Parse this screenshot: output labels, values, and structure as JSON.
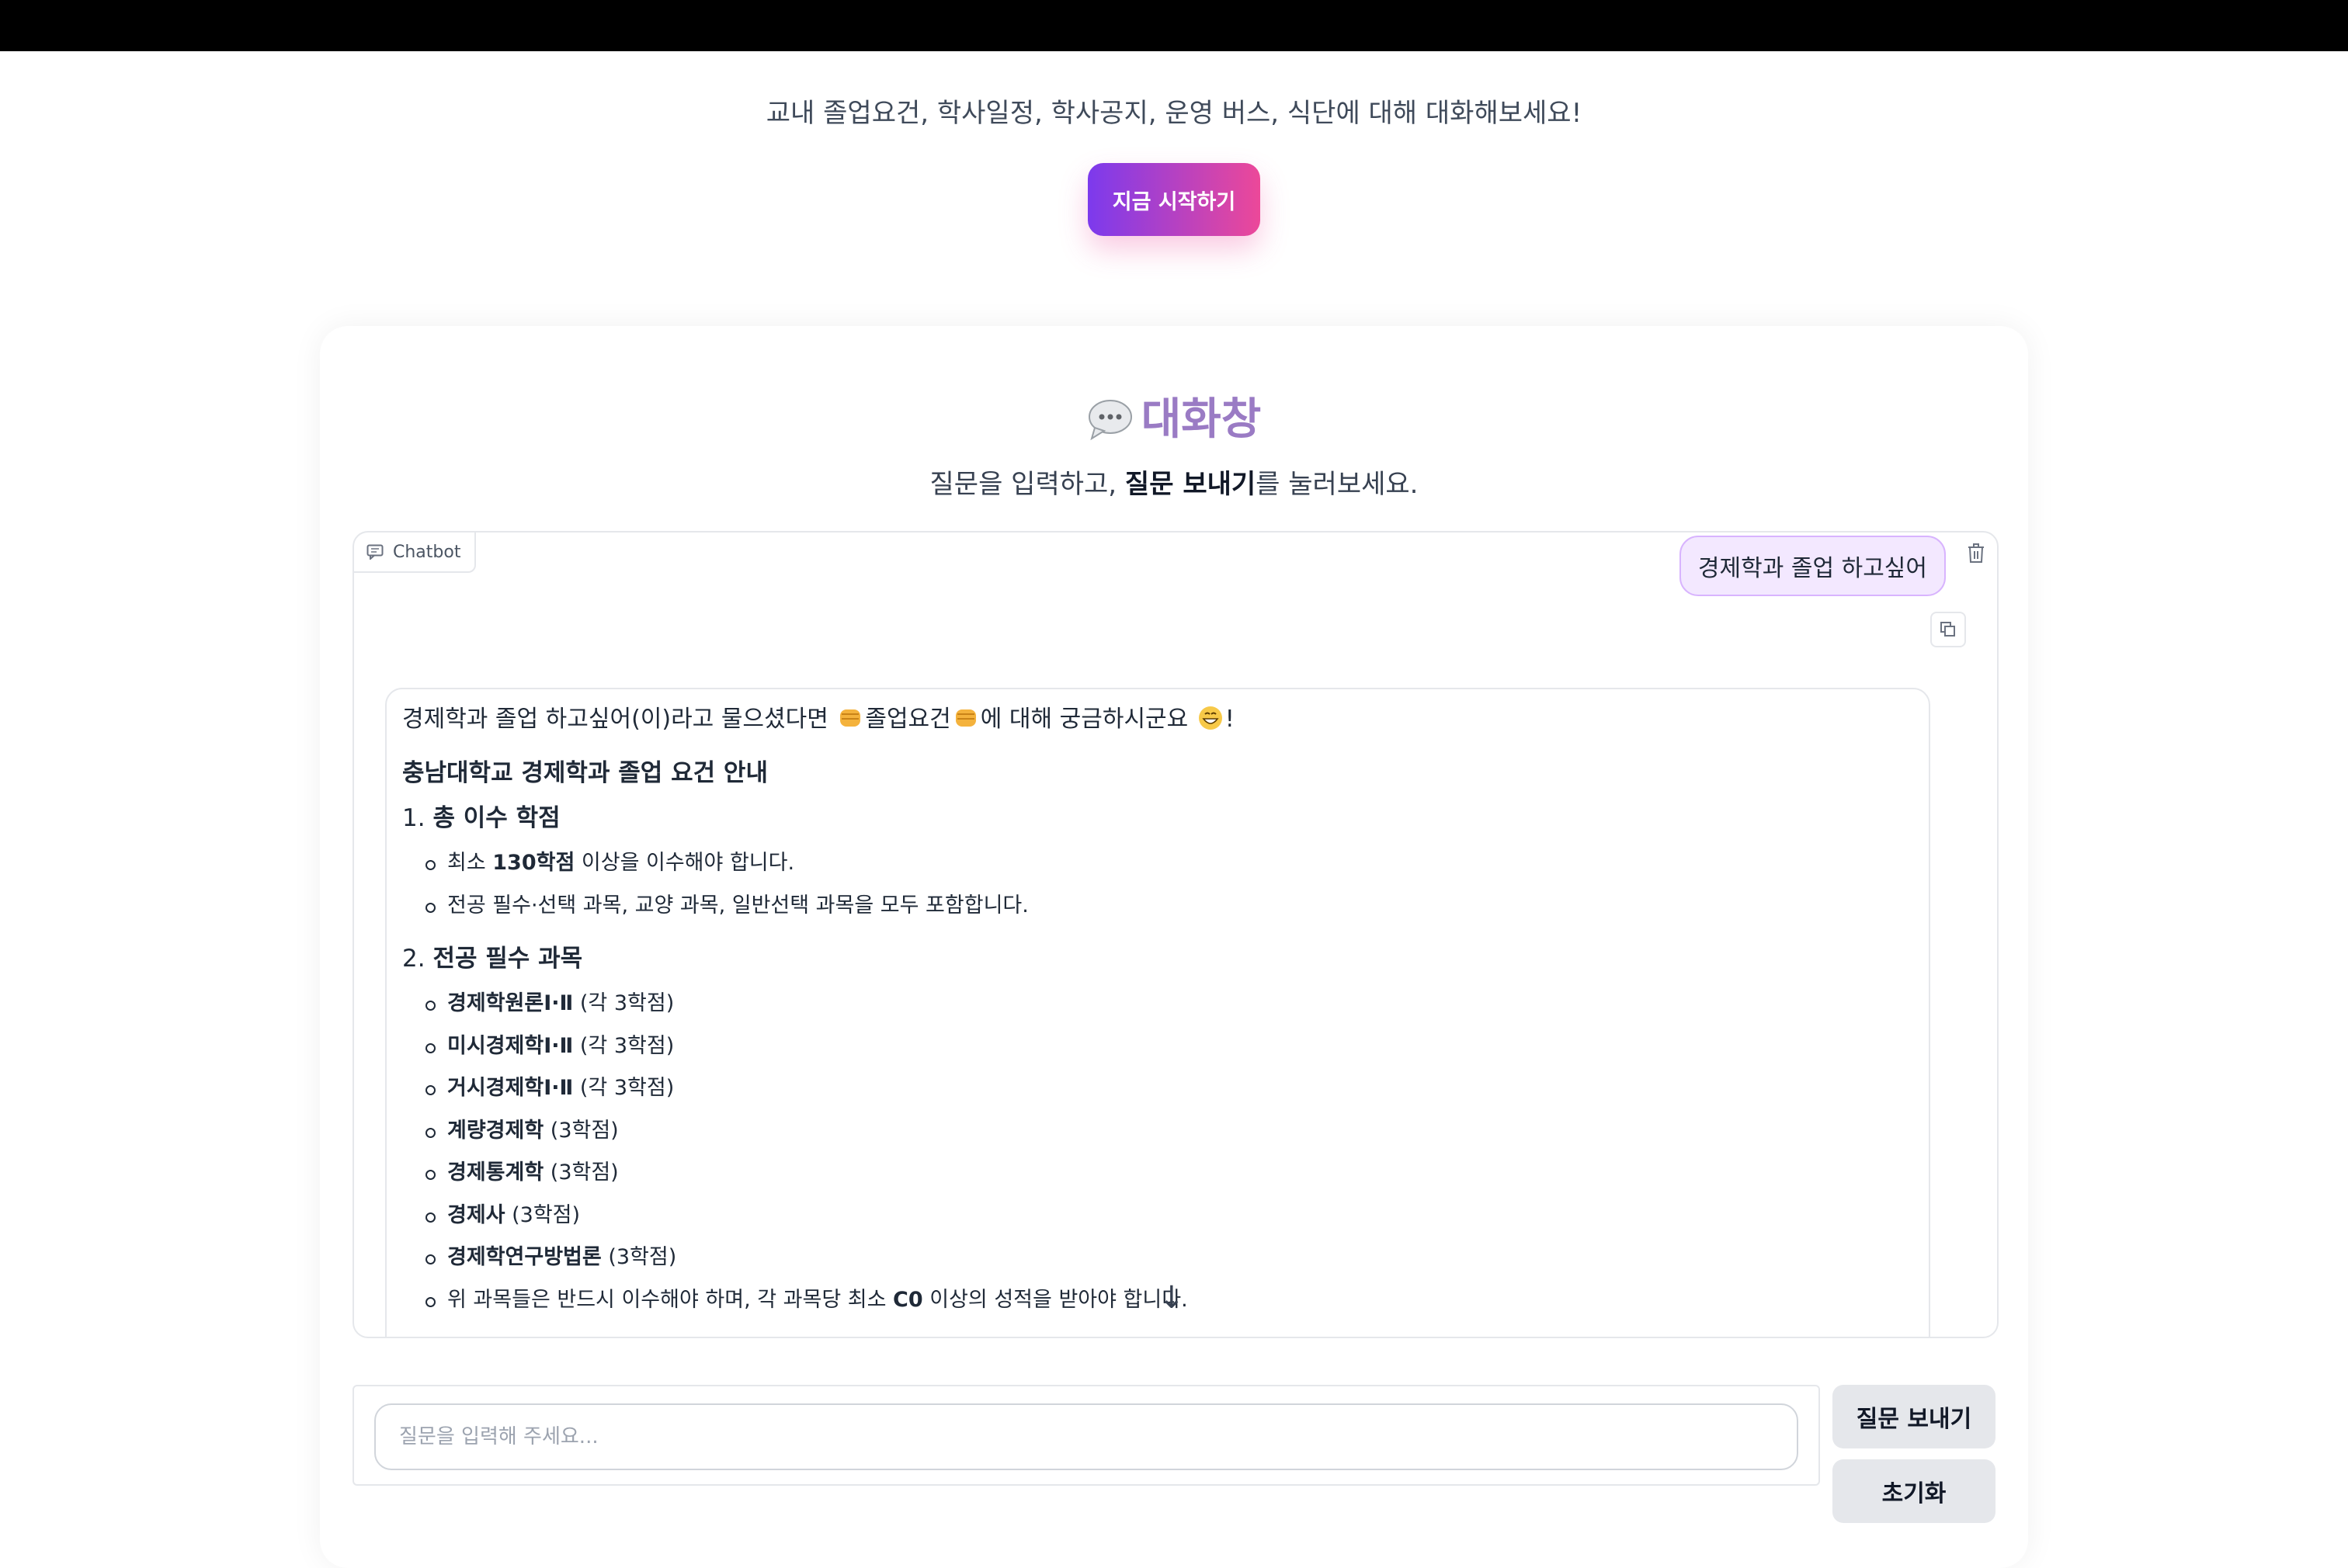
{
  "hero": {
    "subtitle": "교내 졸업요건, 학사일정, 학사공지, 운영 버스, 식단에 대해 대화해보세요!",
    "cta_label": "지금 시작하기"
  },
  "chat_section": {
    "title": "대화창",
    "title_icon": "speech-bubble-icon",
    "instruction_pre": "질문을 입력하고, ",
    "instruction_bold": "질문 보내기",
    "instruction_post": "를 눌러보세요."
  },
  "chatbot": {
    "label": "Chatbot",
    "user_message": "경제학과 졸업 하고싶어",
    "bot": {
      "intro_a": "경제학과 졸업 하고싶어(이)라고 물으셨다면 ",
      "intro_b": "졸업요건",
      "intro_c": "에 대해 궁금하시군요 ",
      "intro_d": "!",
      "guide_title": "충남대학교 경제학과 졸업 요건 안내",
      "sections": [
        {
          "num": "1.",
          "title": "총 이수 학점",
          "items": [
            {
              "pre": "최소 ",
              "bold": "130학점",
              "post": " 이상을 이수해야 합니다."
            },
            {
              "pre": "전공 필수·선택 과목, 교양 과목, 일반선택 과목을 모두 포함합니다.",
              "bold": "",
              "post": ""
            }
          ]
        },
        {
          "num": "2.",
          "title": "전공 필수 과목",
          "items": [
            {
              "pre": "",
              "bold": "경제학원론Ⅰ·Ⅱ",
              "post": " (각 3학점)"
            },
            {
              "pre": "",
              "bold": "미시경제학Ⅰ·Ⅱ",
              "post": " (각 3학점)"
            },
            {
              "pre": "",
              "bold": "거시경제학Ⅰ·Ⅱ",
              "post": " (각 3학점)"
            },
            {
              "pre": "",
              "bold": "계량경제학",
              "post": " (3학점)"
            },
            {
              "pre": "",
              "bold": "경제통계학",
              "post": " (3학점)"
            },
            {
              "pre": "",
              "bold": "경제사",
              "post": " (3학점)"
            },
            {
              "pre": "",
              "bold": "경제학연구방법론",
              "post": " (3학점)"
            },
            {
              "pre": "위 과목들은 반드시 이수해야 하며, 각 과목당 최소 ",
              "bold": "C0",
              "post": " 이상의 성적을 받아야 합니다."
            }
          ]
        }
      ]
    }
  },
  "input": {
    "placeholder": "질문을 입력해 주세요...",
    "value": ""
  },
  "buttons": {
    "send": "질문 보내기",
    "reset": "초기화"
  }
}
